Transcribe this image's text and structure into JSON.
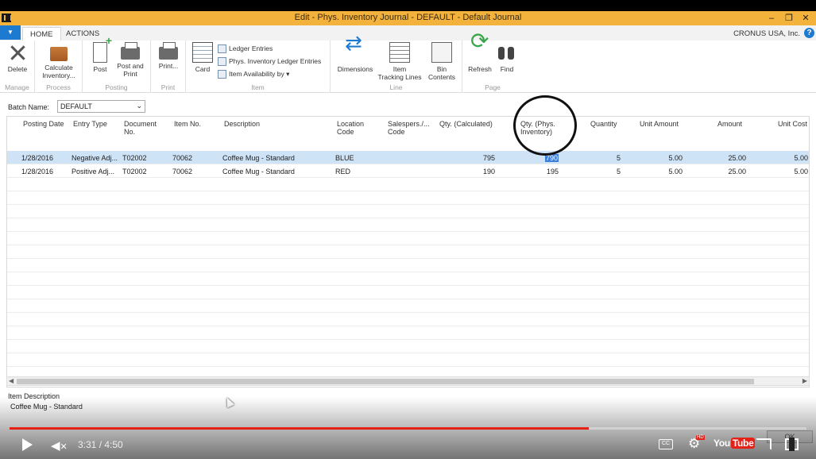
{
  "window": {
    "title": "Edit - Phys. Inventory Journal - DEFAULT - Default Journal",
    "minimize": "–",
    "restore": "❐",
    "close": "✕"
  },
  "tabs": {
    "menu": "▼",
    "home": "HOME",
    "actions": "ACTIONS"
  },
  "company": "CRONUS USA, Inc.",
  "help": "?",
  "ribbon": {
    "groups": {
      "manage": "Manage",
      "process": "Process",
      "posting": "Posting",
      "print": "Print",
      "item": "Item",
      "line": "Line",
      "page": "Page"
    },
    "delete": "Delete",
    "calculate_1": "Calculate",
    "calculate_2": "Inventory...",
    "post": "Post",
    "post_print_1": "Post and",
    "post_print_2": "Print",
    "print": "Print...",
    "card": "Card",
    "ledger_entries": "Ledger Entries",
    "phys_ledger_entries": "Phys. Inventory Ledger Entries",
    "item_availability": "Item Availability by ▾",
    "dimensions": "Dimensions",
    "item_tracking_1": "Item",
    "item_tracking_2": "Tracking Lines",
    "bin_contents_1": "Bin",
    "bin_contents_2": "Contents",
    "refresh": "Refresh",
    "find": "Find"
  },
  "batch": {
    "label": "Batch Name:",
    "value": "DEFAULT",
    "chevron": "⌄"
  },
  "columns": {
    "posting_date": "Posting Date",
    "entry_type": "Entry Type",
    "document_no_1": "Document",
    "document_no_2": "No.",
    "item_no": "Item No.",
    "description": "Description",
    "location_1": "Location",
    "location_2": "Code",
    "salesperson_1": "Salespers./...",
    "salesperson_2": "Code",
    "qty_calc": "Qty. (Calculated)",
    "qty_phys_1": "Qty. (Phys.",
    "qty_phys_2": "Inventory)",
    "quantity": "Quantity",
    "unit_amount": "Unit Amount",
    "amount": "Amount",
    "unit_cost": "Unit Cost"
  },
  "rows": [
    {
      "posting_date": "1/28/2016",
      "entry_type": "Negative Adj...",
      "document_no": "T02002",
      "item_no": "70062",
      "description": "Coffee Mug - Standard",
      "location": "BLUE",
      "qty_calc": "795",
      "qty_phys": "790",
      "quantity": "5",
      "unit_amount": "5.00",
      "amount": "25.00",
      "unit_cost": "5.00"
    },
    {
      "posting_date": "1/28/2016",
      "entry_type": "Positive Adj...",
      "document_no": "T02002",
      "item_no": "70062",
      "description": "Coffee Mug - Standard",
      "location": "RED",
      "qty_calc": "190",
      "qty_phys": "195",
      "quantity": "5",
      "unit_amount": "5.00",
      "amount": "25.00",
      "unit_cost": "5.00"
    }
  ],
  "scroll": {
    "left": "◀",
    "right": "▶"
  },
  "factbox": {
    "label": "Item Description",
    "value": "Coffee Mug - Standard"
  },
  "ok": "OK",
  "video": {
    "time": "3:31 / 4:50",
    "progress": 0.727,
    "mute": "✕",
    "cc": "CC",
    "hd": "HD",
    "gear": "⚙",
    "youtube_1": "You",
    "youtube_2": "Tube"
  }
}
